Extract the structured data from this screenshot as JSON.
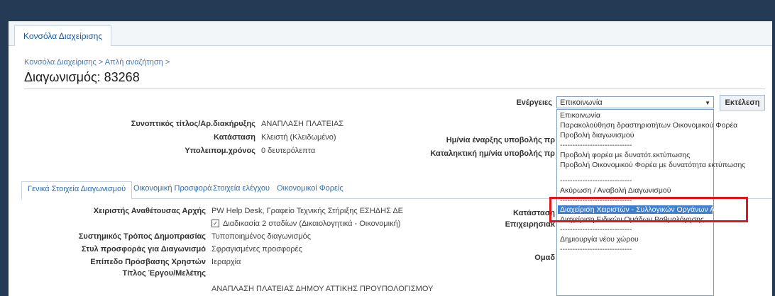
{
  "header": {
    "main_tab": "Κονσόλα Διαχείρισης"
  },
  "breadcrumb": [
    "Κονσόλα Διαχείρισης",
    ">",
    "Απλή αναζήτηση",
    ">"
  ],
  "page_title": "Διαγωνισμός: 83268",
  "actions": {
    "label": "Ενέργειες",
    "selected": "Επικοινωνία",
    "execute_label": "Εκτέλεση",
    "options": [
      "Επικοινωνία",
      "Παρακολούθηση δραστηριοτήτων Οικονομικού Φορέα",
      "Προβολή διαγωνισμού",
      "-----------------------------",
      "Προβολή φορέα με δυνατότ.εκτύπωσης",
      "Προβολή Οικονομικού Φορέα με δυνατότητα εκτύπωσης",
      "-----------------------------",
      "Ακύρωση / Αναβολή Διαγωνισμού",
      "-----------------------------",
      "Διαχείριση Χειριστών - Συλλογικών Οργάνων Αξιολόγησης",
      "Διαχείριση Ειδικών Ομάδων Βαθμολόγησης",
      "-----------------------------",
      "Δημιουργία νέου χώρου",
      "-----------------------------"
    ]
  },
  "summary": {
    "short_title_label": "Συνοπτικός τίτλος/Αρ.διακήρυξης",
    "short_title_value": "ΑΝΑΠΛΑΣΗ ΠΛΑΤΕΙΑΣ",
    "status_label": "Κατάσταση",
    "status_value": "Κλειστή (Κλειδωμένο)",
    "remaining_label": "Υπολειπομ.χρόνος",
    "remaining_value": "0 δευτερόλεπτα",
    "start_date_label": "Ημ/νία έναρξης υποβολής πρ",
    "end_date_label": "Καταληκτική ημ/νία υποβολής πρ"
  },
  "subtabs": [
    "Γενικά Στοιχεία Διαγωνισμού",
    "Οικονομική Προσφορά",
    "Στοιχεία ελέγχου",
    "Οικονομικοί Φορείς"
  ],
  "details": {
    "operator_label": "Χειριστής Αναθέτουσας Αρχής",
    "operator_value": "PW Help Desk, Γραφείο Τεχνικής Στήριξης ΕΣΗΔΗΣ ΔΕ",
    "two_stage": "Διαδικασία 2 σταδίων (Δικαιολογητικά - Οικονομική)",
    "auction_label": "Συστημικός Τρόπος Δημοπρασίας",
    "auction_value": "Τυποποιημένος διαγωνισμός",
    "offer_style_label": "Στυλ προσφοράς για Διαγωνισμό",
    "offer_style_value": "Σφραγισμένες προσφορές",
    "access_label": "Επίπεδο Πρόσβασης Χρηστών",
    "access_value": "Ιεραρχία",
    "project_title_label": "Τίτλος Έργου/Μελέτης",
    "project_title_value": "ΑΝΑΠΛΑΣΗ ΠΛΑΤΕΙΑΣ ΔΗΜΟΥ ΑΤΤΙΚΗΣ ΠΡΟΥΠΟΛΟΓΙΣΜΟΥ",
    "right_status_label": "Κατάσταση",
    "right_business_label": "Επιχειρησιακ",
    "right_group_label": "Ομαδ"
  },
  "colors": {
    "frame": "#243a55",
    "link": "#2e6db4",
    "highlight": "#3f7fd0",
    "callout": "#e0161e"
  }
}
